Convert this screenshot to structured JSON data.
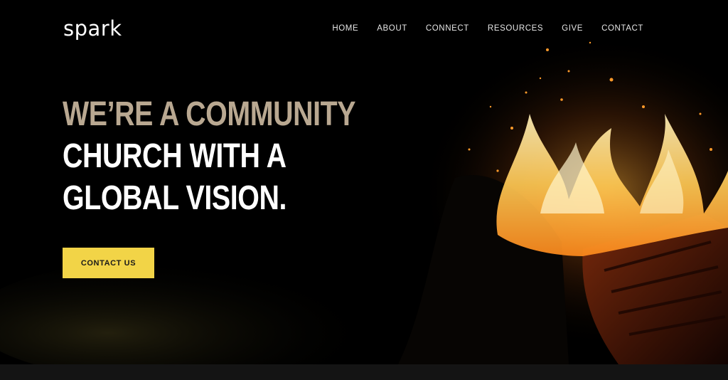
{
  "brand": {
    "logo_text": "spark"
  },
  "nav": {
    "items": [
      {
        "label": "HOME"
      },
      {
        "label": "ABOUT"
      },
      {
        "label": "CONNECT"
      },
      {
        "label": "RESOURCES"
      },
      {
        "label": "GIVE"
      },
      {
        "label": "CONTACT"
      }
    ]
  },
  "hero": {
    "headline_lines": [
      "WE’RE A COMMUNITY",
      "CHURCH WITH A",
      "GLOBAL VISION."
    ],
    "cta_label": "CONTACT US"
  },
  "colors": {
    "background": "#000000",
    "accent_text": "#b9a891",
    "button": "#f2d447",
    "footer_bar": "#141414"
  }
}
